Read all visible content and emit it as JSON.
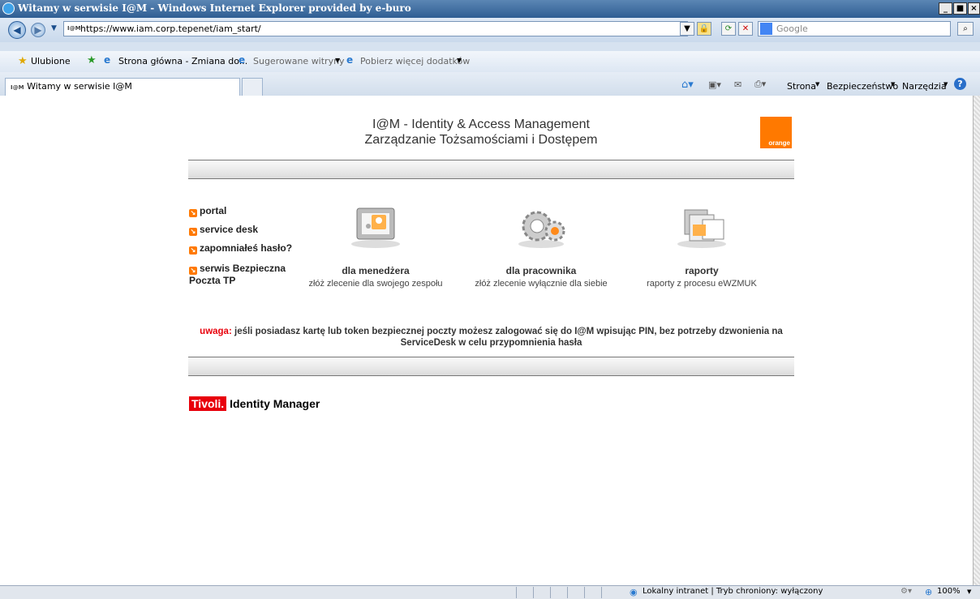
{
  "window": {
    "title": "Witamy w serwisie I@M - Windows Internet Explorer provided by e-buro",
    "controls": [
      "_",
      "■",
      "×"
    ]
  },
  "addressbar": {
    "url": "https://www.iam.corp.tepenet/iam_start/",
    "favicon_text": "I@M",
    "search_placeholder": "Google"
  },
  "favorites": {
    "label": "Ulubione",
    "items": [
      "Strona główna - Zmiana do...",
      "Sugerowane witryny",
      "Pobierz więcej dodatków"
    ]
  },
  "tabs": {
    "active_label": "Witamy w serwisie I@M"
  },
  "commandbar": {
    "page": "Strona",
    "safety": "Bezpieczeństwo",
    "tools": "Narzędzia"
  },
  "page": {
    "header_line1": "I@M - Identity & Access Management",
    "header_line2": "Zarządzanie Tożsamościami i Dostępem",
    "logo_text": "orange",
    "links": [
      "portal",
      "service desk",
      "zapomniałeś hasło?",
      "serwis Bezpieczna Poczta TP"
    ],
    "categories": [
      {
        "title": "dla menedżera",
        "desc": "złóż zlecenie dla swojego zespołu",
        "icon": "manager-icon"
      },
      {
        "title": "dla pracownika",
        "desc": "złóż zlecenie wyłącznie dla siebie",
        "icon": "gears-icon"
      },
      {
        "title": "raporty",
        "desc": "raporty z procesu eWZMUK",
        "icon": "reports-icon"
      }
    ],
    "warning_label": "uwaga:",
    "warning_text": "jeśli posiadasz kartę lub token bezpiecznej poczty możesz zalogować się do I@M wpisując PIN, bez potrzeby dzwonienia na ServiceDesk w celu przypomnienia hasła",
    "tivoli_brand": "Tivoli.",
    "tivoli_product": "Identity Manager"
  },
  "statusbar": {
    "zone": "Lokalny intranet | Tryb chroniony: wyłączony",
    "zoom": "100%"
  },
  "colors": {
    "accent": "#ff7900",
    "warning_red": "#e8000b",
    "titlebar": "#2f5e93"
  }
}
